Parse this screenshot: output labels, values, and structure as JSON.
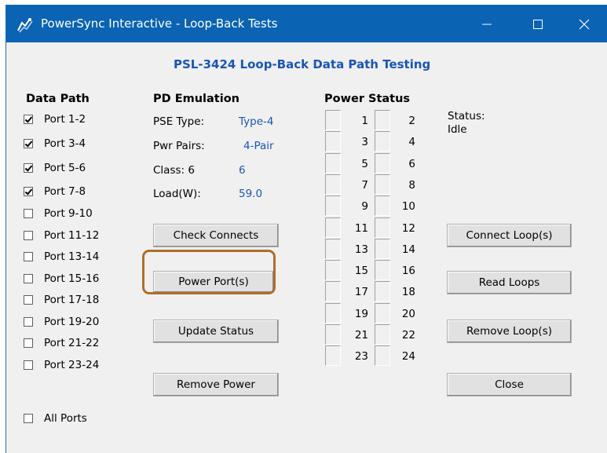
{
  "window": {
    "title": "PowerSync Interactive - Loop-Back Tests",
    "controls": {
      "minimize": "—",
      "maximize": "☐",
      "close": "✕"
    }
  },
  "header": "PSL-3424 Loop-Back Data Path Testing",
  "data_path": {
    "heading": "Data Path",
    "ports": [
      {
        "label": "Port 1-2",
        "checked": true
      },
      {
        "label": "Port 3-4",
        "checked": true
      },
      {
        "label": "Port 5-6",
        "checked": true
      },
      {
        "label": "Port 7-8",
        "checked": true
      },
      {
        "label": "Port 9-10",
        "checked": false
      },
      {
        "label": "Port 11-12",
        "checked": false
      },
      {
        "label": "Port 13-14",
        "checked": false
      },
      {
        "label": "Port 15-16",
        "checked": false
      },
      {
        "label": "Port 17-18",
        "checked": false
      },
      {
        "label": "Port 19-20",
        "checked": false
      },
      {
        "label": "Port 21-22",
        "checked": false
      },
      {
        "label": "Port 23-24",
        "checked": false
      }
    ],
    "all_ports": {
      "label": "All Ports",
      "checked": false
    }
  },
  "pd_emulation": {
    "heading": "PD Emulation",
    "pse_type_label": "PSE Type:",
    "pse_type_value": "Type-4",
    "pwr_pairs_label": "Pwr Pairs:",
    "pwr_pairs_value": "4-Pair",
    "class_label": "Class: 6",
    "class_value": "6",
    "load_label": "Load(W):",
    "load_value": "59.0"
  },
  "buttons": {
    "check_connects": "Check Connects",
    "power_ports": "Power Port(s)",
    "update_status": "Update Status",
    "remove_power": "Remove Power",
    "connect_loops": "Connect Loop(s)",
    "read_loops": "Read Loops",
    "remove_loops": "Remove Loop(s)",
    "close": "Close"
  },
  "power_status": {
    "heading": "Power Status",
    "rows": [
      [
        "1",
        "2"
      ],
      [
        "3",
        "4"
      ],
      [
        "5",
        "6"
      ],
      [
        "7",
        "8"
      ],
      [
        "9",
        "10"
      ],
      [
        "11",
        "12"
      ],
      [
        "13",
        "14"
      ],
      [
        "15",
        "16"
      ],
      [
        "17",
        "18"
      ],
      [
        "19",
        "20"
      ],
      [
        "21",
        "22"
      ],
      [
        "23",
        "24"
      ]
    ]
  },
  "status": {
    "label": "Status:",
    "value": "Idle"
  },
  "colors": {
    "titlebar": "#0a63b3",
    "accent_text": "#1a55b5",
    "highlight_box": "#b06d2c",
    "window_bg": "#f0f0f0"
  }
}
